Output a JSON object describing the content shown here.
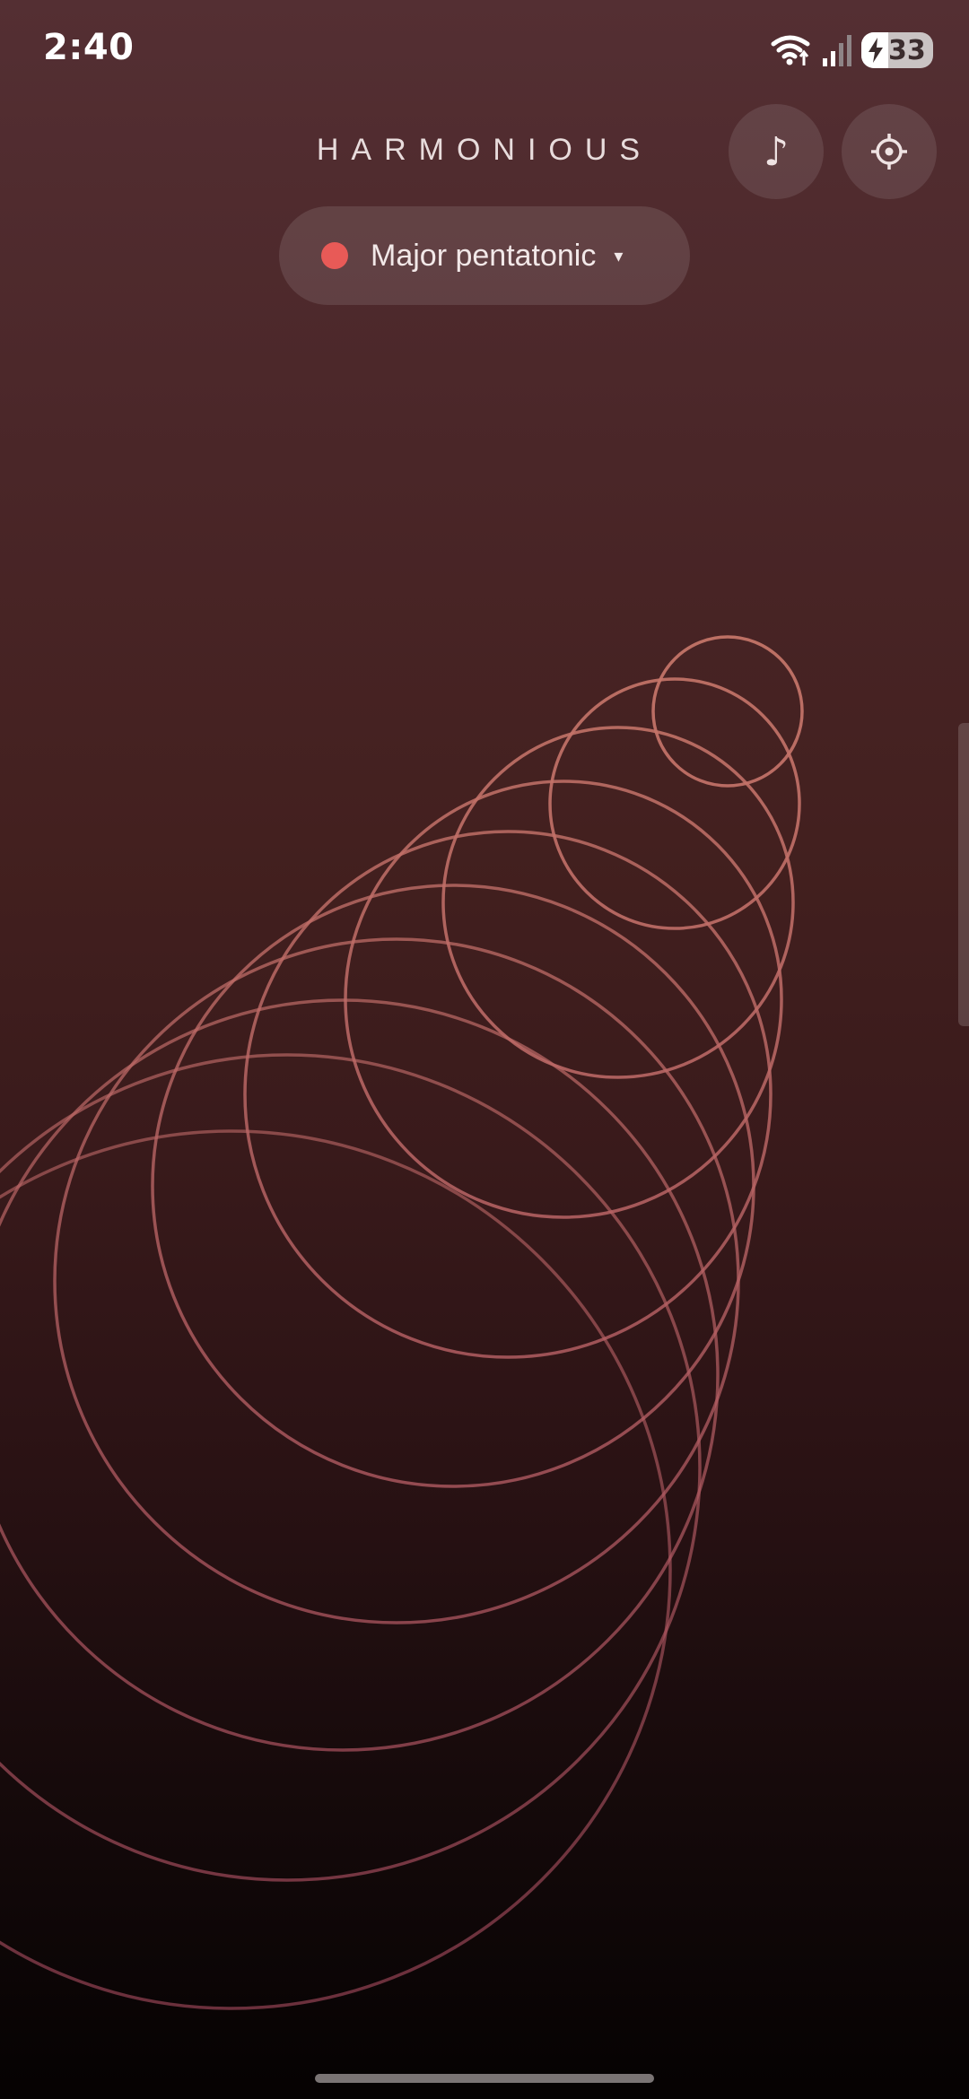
{
  "status_bar": {
    "time": "2:40",
    "battery_level": "33",
    "icons": [
      "wifi-icon",
      "signal-icon",
      "battery-charging-icon"
    ]
  },
  "header": {
    "app_title": "HARMONIOUS",
    "music_button_icon": "♪",
    "settings_button_icon": "gear-icon"
  },
  "scale_selector": {
    "label": "Major pentatonic",
    "caret": "▾",
    "dot_color": "#e85a57"
  },
  "theme": {
    "ring_color_top": "#c7776a",
    "ring_color_bottom": "#a64a5e"
  }
}
